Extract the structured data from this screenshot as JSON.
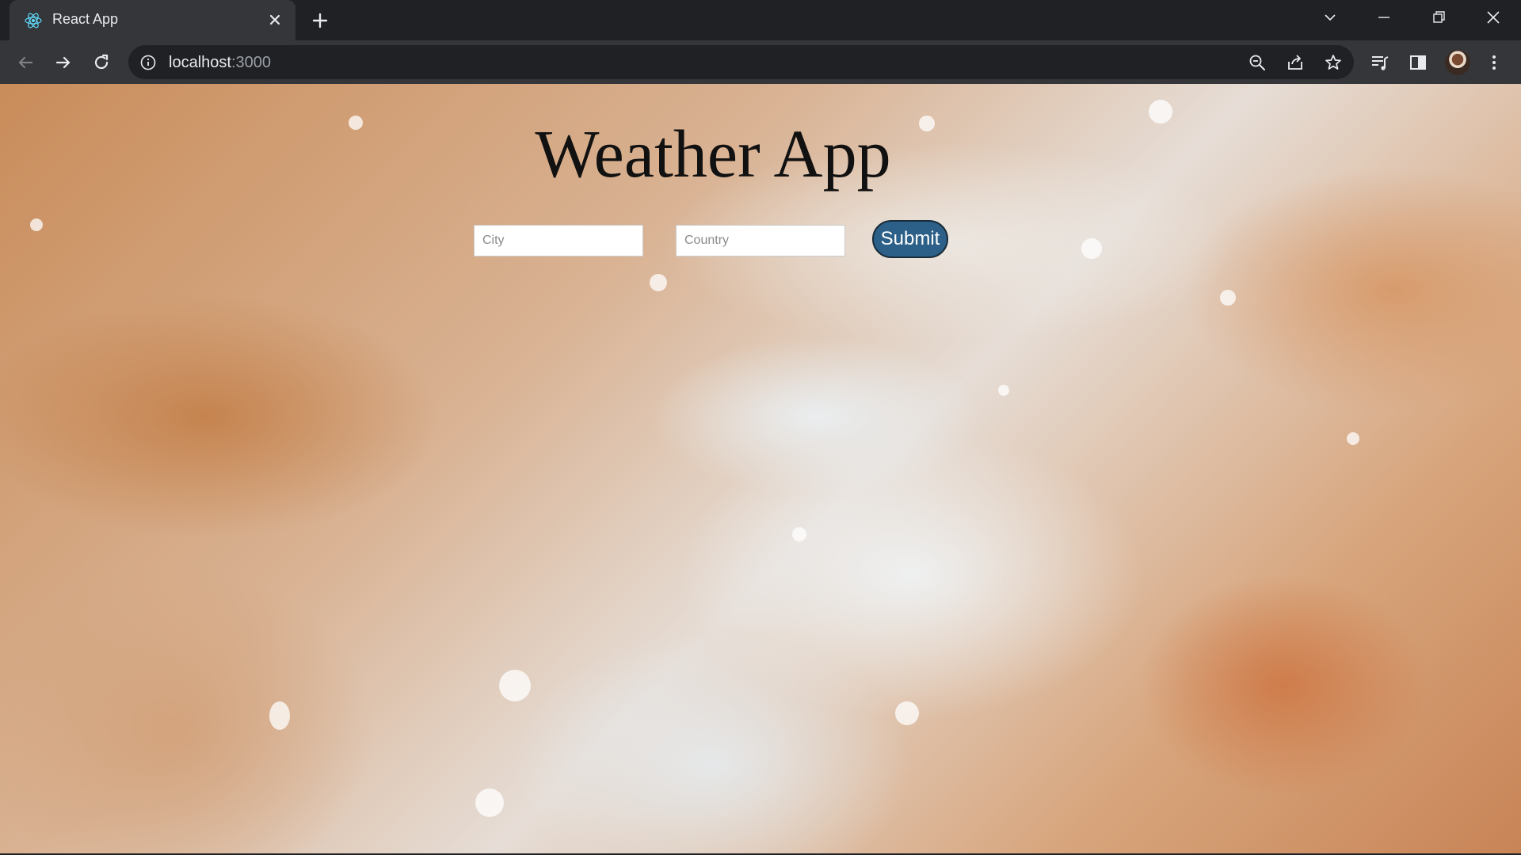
{
  "browser": {
    "tab": {
      "title": "React App",
      "favicon": "react-icon",
      "close_icon": "close-icon"
    },
    "new_tab_icon": "plus-icon",
    "window_controls": [
      "chevron-down-icon",
      "minimize-icon",
      "restore-icon",
      "close-icon"
    ],
    "toolbar": {
      "back_icon": "arrow-left-icon",
      "forward_icon": "arrow-right-icon",
      "reload_icon": "reload-icon",
      "url": {
        "host": "localhost",
        "port": ":3000"
      },
      "omnibox_icons": [
        "zoom-out-icon",
        "share-icon",
        "star-icon"
      ],
      "right_icons": [
        "media-queue-icon",
        "side-panel-icon",
        "avatar",
        "kebab-menu-icon"
      ]
    }
  },
  "page": {
    "title": "Weather App",
    "city": {
      "placeholder": "City",
      "value": ""
    },
    "country": {
      "placeholder": "Country",
      "value": ""
    },
    "submit_label": "Submit"
  },
  "colors": {
    "chrome_dark": "#202124",
    "chrome_toolbar": "#35363a",
    "submit_bg": "#2c6088",
    "submit_border": "#1a2c3a"
  }
}
